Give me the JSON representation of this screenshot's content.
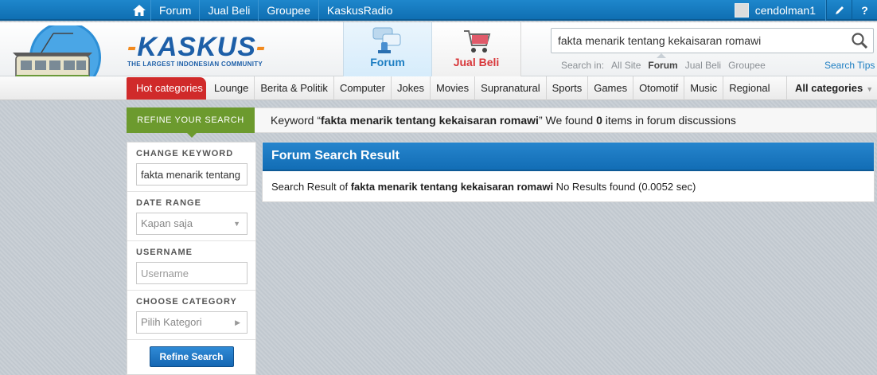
{
  "topbar": {
    "nav": [
      "Forum",
      "Jual Beli",
      "Groupee",
      "KaskusRadio"
    ],
    "username": "cendolman1"
  },
  "header": {
    "logo_word": "KASKUS",
    "logo_tagline": "THE LARGEST INDONESIAN COMMUNITY",
    "tab_forum": "Forum",
    "tab_jualbeli": "Jual Beli",
    "search_value": "fakta menarik tentang kekaisaran romawi",
    "search_in_label": "Search in:",
    "search_in_options": [
      "All Site",
      "Forum",
      "Jual Beli",
      "Groupee"
    ],
    "search_in_active": "Forum",
    "search_tips": "Search Tips"
  },
  "categories": {
    "hot": "Hot categories",
    "items": [
      "Lounge",
      "Berita & Politik",
      "Computer",
      "Jokes",
      "Movies",
      "Supranatural",
      "Sports",
      "Games",
      "Otomotif",
      "Music",
      "Regional"
    ],
    "all": "All categories"
  },
  "refine": {
    "button": "REFINE YOUR SEARCH",
    "msg_prefix": "Keyword “",
    "keyword": "fakta menarik tentang kekaisaran romawi",
    "msg_mid": "” We found ",
    "count": "0",
    "msg_suffix": " items in forum discussions"
  },
  "sidebar": {
    "change_keyword_title": "CHANGE KEYWORD",
    "change_keyword_value": "fakta menarik tentang kekaisaran romawi",
    "date_range_title": "DATE RANGE",
    "date_range_value": "Kapan saja",
    "username_title": "USERNAME",
    "username_placeholder": "Username",
    "category_title": "CHOOSE CATEGORY",
    "category_value": "Pilih Kategori",
    "refine_button": "Refine Search"
  },
  "result": {
    "title": "Forum Search Result",
    "prefix": "Search Result of ",
    "keyword": "fakta menarik tentang kekaisaran romawi",
    "suffix": " No Results found (0.0052 sec)"
  }
}
